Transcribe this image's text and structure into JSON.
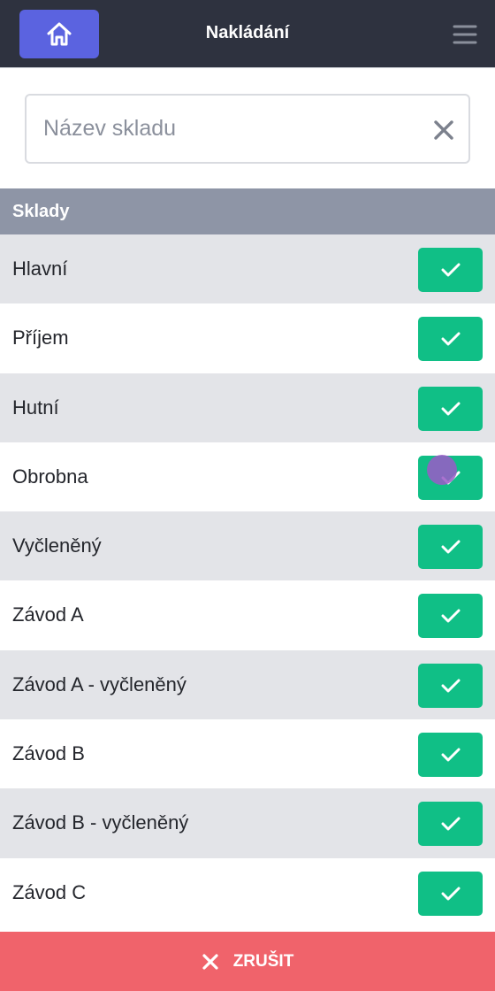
{
  "header": {
    "title": "Nakládání",
    "home_icon": "home-icon",
    "menu_icon": "hamburger-menu-icon",
    "background": "#2e323f",
    "home_button_color": "#5b63e0"
  },
  "search": {
    "placeholder": "Název skladu",
    "value": "",
    "clear_icon": "close-icon"
  },
  "section": {
    "title": "Sklady",
    "background": "#8e95a6"
  },
  "warehouses": [
    {
      "label": "Hlavní",
      "selected": true
    },
    {
      "label": "Příjem",
      "selected": true
    },
    {
      "label": "Hutní",
      "selected": true
    },
    {
      "label": "Obrobna",
      "selected": true
    },
    {
      "label": "Vyčleněný",
      "selected": true
    },
    {
      "label": "Závod A",
      "selected": true
    },
    {
      "label": "Závod A - vyčleněný",
      "selected": true
    },
    {
      "label": "Závod B",
      "selected": true
    },
    {
      "label": "Závod B - vyčleněný",
      "selected": true
    },
    {
      "label": "Závod C",
      "selected": true
    }
  ],
  "check_button_color": "#10bf86",
  "footer": {
    "cancel_label": "ZRUŠIT",
    "cancel_icon": "close-icon",
    "background": "#f0636b"
  }
}
